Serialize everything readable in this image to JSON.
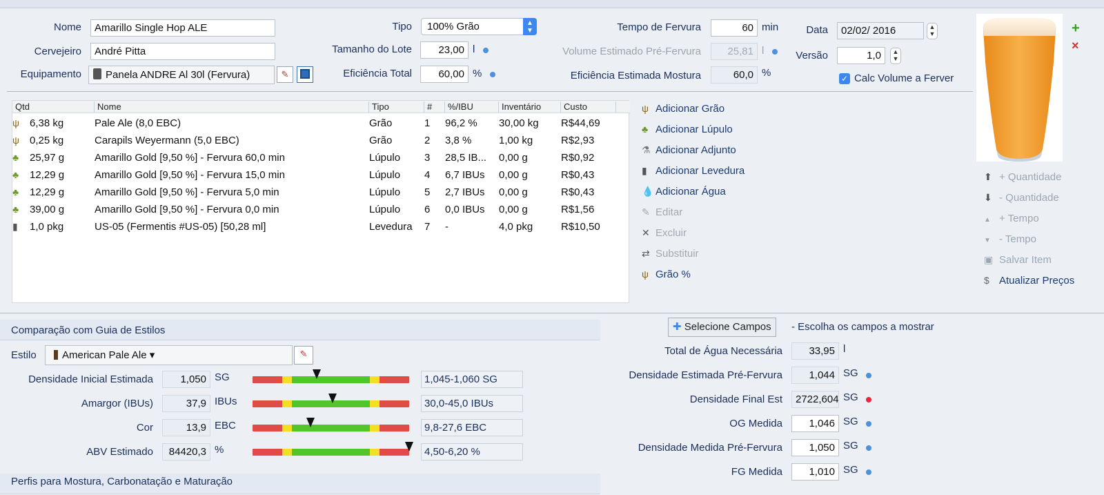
{
  "recipe": {
    "nome_label": "Nome",
    "nome_value": "Amarillo Single Hop ALE",
    "cervejeiro_label": "Cervejeiro",
    "cervejeiro_value": "André Pitta",
    "equipamento_label": "Equipamento",
    "equipamento_value": "Panela ANDRE Al 30l (Fervura)",
    "tipo_label": "Tipo",
    "tipo_value": "100% Grão",
    "tamanho_label": "Tamanho do Lote",
    "tamanho_value": "23,00",
    "tamanho_unit": "l",
    "eficiencia_label": "Eficiência Total",
    "eficiencia_value": "60,00",
    "eficiencia_unit": "%",
    "tempo_label": "Tempo de Fervura",
    "tempo_value": "60",
    "tempo_unit": "min",
    "volume_label": "Volume Estimado Pré-Fervura",
    "volume_value": "25,81",
    "volume_unit": "l",
    "ef_mostura_label": "Eficiência Estimada Mostura",
    "ef_mostura_value": "60,0",
    "ef_mostura_unit": "%",
    "data_label": "Data",
    "data_value": "02/02/ 2016",
    "versao_label": "Versão",
    "versao_value": "1,0",
    "calc_label": "Calc Volume a Ferver"
  },
  "table": {
    "headers": [
      "Qtd",
      "Nome",
      "Tipo",
      "#",
      "%/IBU",
      "Inventário",
      "Custo"
    ],
    "rows": [
      {
        "icon": "grain-icon",
        "qtd": "6,38 kg",
        "nome": "Pale Ale (8,0 EBC)",
        "tipo": "Grão",
        "num": "1",
        "ibu": "96,2 %",
        "inv": "30,00 kg",
        "custo": "R$44,69"
      },
      {
        "icon": "grain-icon",
        "qtd": "0,25 kg",
        "nome": "Carapils Weyermann (5,0 EBC)",
        "tipo": "Grão",
        "num": "2",
        "ibu": "3,8 %",
        "inv": "1,00 kg",
        "custo": "R$2,93"
      },
      {
        "icon": "hop-icon",
        "qtd": "25,97 g",
        "nome": "Amarillo Gold [9,50 %] - Fervura 60,0 min",
        "tipo": "Lúpulo",
        "num": "3",
        "ibu": "28,5 IB...",
        "inv": "0,00 g",
        "custo": "R$0,92"
      },
      {
        "icon": "hop-icon",
        "qtd": "12,29 g",
        "nome": "Amarillo Gold [9,50 %] - Fervura 15,0 min",
        "tipo": "Lúpulo",
        "num": "4",
        "ibu": "6,7 IBUs",
        "inv": "0,00 g",
        "custo": "R$0,43"
      },
      {
        "icon": "hop-icon",
        "qtd": "12,29 g",
        "nome": "Amarillo Gold [9,50 %] - Fervura 5,0 min",
        "tipo": "Lúpulo",
        "num": "5",
        "ibu": "2,7 IBUs",
        "inv": "0,00 g",
        "custo": "R$0,43"
      },
      {
        "icon": "hop-icon",
        "qtd": "39,00 g",
        "nome": "Amarillo Gold [9,50 %] - Fervura 0,0 min",
        "tipo": "Lúpulo",
        "num": "6",
        "ibu": "0,0 IBUs",
        "inv": "0,00 g",
        "custo": "R$1,56"
      },
      {
        "icon": "yeast-icon",
        "qtd": "1,0 pkg",
        "nome": "US-05 (Fermentis #US-05) [50,28 ml]",
        "tipo": "Levedura",
        "num": "7",
        "ibu": "-",
        "inv": "4,0 pkg",
        "custo": "R$10,50"
      }
    ]
  },
  "actions": {
    "add_grain": "Adicionar Grão",
    "add_hop": "Adicionar Lúpulo",
    "add_adjunct": "Adicionar Adjunto",
    "add_yeast": "Adicionar Levedura",
    "add_water": "Adicionar Água",
    "edit": "Editar",
    "delete": "Excluir",
    "replace": "Substituir",
    "grain_pct": "Grão %"
  },
  "right_actions": {
    "qty_up": "+ Quantidade",
    "qty_down": "- Quantidade",
    "time_up": "+ Tempo",
    "time_down": "- Tempo",
    "save_item": "Salvar Item",
    "update_prices": "Atualizar Preços"
  },
  "style": {
    "section_title": "Comparação com Guia de Estilos",
    "estilo_label": "Estilo",
    "estilo_value": "American Pale Ale",
    "rows": [
      {
        "label": "Densidade Inicial Estimada",
        "value": "1,050",
        "unit": "SG",
        "range": "1,045-1,060 SG",
        "marker_pct": 41
      },
      {
        "label": "Amargor (IBUs)",
        "value": "37,9",
        "unit": "IBUs",
        "range": "30,0-45,0 IBUs",
        "marker_pct": 51
      },
      {
        "label": "Cor",
        "value": "13,9",
        "unit": "EBC",
        "range": "9,8-27,6 EBC",
        "marker_pct": 37
      },
      {
        "label": "ABV Estimado",
        "value": "84420,3",
        "unit": "%",
        "range": "4,50-6,20 %",
        "marker_pct": 100
      }
    ],
    "next_section": "Perfis para Mostura, Carbonatação e Maturação"
  },
  "fields": {
    "select_button": "Selecione Campos",
    "select_hint": "- Escolha os campos a mostrar",
    "rows": [
      {
        "label": "Total de Água Necessária",
        "value": "33,95",
        "unit": "l",
        "dot": "none",
        "ro": true
      },
      {
        "label": "Densidade Estimada Pré-Fervura",
        "value": "1,044",
        "unit": "SG",
        "dot": "blue",
        "ro": true
      },
      {
        "label": "Densidade Final Est",
        "value": "2722,604",
        "unit": "SG",
        "dot": "red",
        "ro": true
      },
      {
        "label": "OG Medida",
        "value": "1,046",
        "unit": "SG",
        "dot": "blue",
        "ro": false
      },
      {
        "label": "Densidade Medida Pré-Fervura",
        "value": "1,050",
        "unit": "SG",
        "dot": "blue",
        "ro": false
      },
      {
        "label": "FG Medida",
        "value": "1,010",
        "unit": "SG",
        "dot": "blue",
        "ro": false
      }
    ]
  },
  "colors": {
    "label": "#1a2e5a",
    "accent": "#3d88f0",
    "dot_blue": "#4d91db",
    "dot_red": "#e8283a",
    "scale_red": "#e14b47",
    "scale_green": "#52c52a",
    "scale_yellow": "#f3df23"
  }
}
